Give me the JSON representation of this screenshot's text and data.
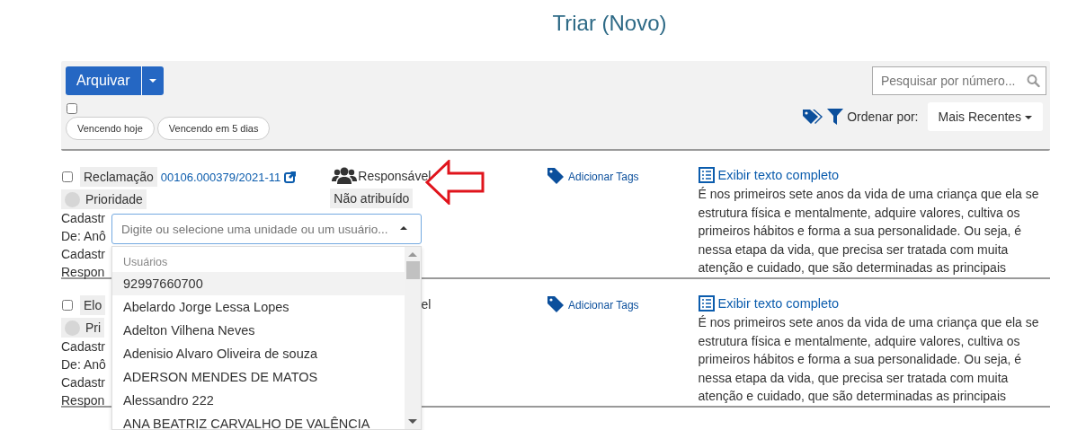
{
  "title": "Triar (Novo)",
  "toolbar": {
    "archive_button": "Arquivar",
    "select_all_checked": false,
    "filters": [
      {
        "label": "Vencendo hoje",
        "selected": false
      },
      {
        "label": "Vencendo em 5 dias",
        "selected": false
      }
    ],
    "search": {
      "placeholder": "Pesquisar por número..."
    },
    "sort_label": "Ordenar por:",
    "sort_value": "Mais Recentes"
  },
  "items": [
    {
      "checked": false,
      "type": "Reclamação",
      "number": "00106.000379/2021-11",
      "responsible_label": "Responsável",
      "priority": "Prioridade",
      "assignee": "Não atribuído",
      "details": [
        "Cadastr",
        "De: Anô",
        "Cadastr",
        "Respon"
      ],
      "tags_link": "Adicionar Tags",
      "full_text_link": "Exibir texto completo",
      "text": "É nos primeiros sete anos da vida de uma criança que ela se estrutura física e mentalmente, adquire valores, cultiva os primeiros hábitos e forma a sua personalidade. Ou seja, é nessa etapa da vida, que precisa ser tratada com muita atenção e cuidado, que são determinadas as principais"
    },
    {
      "checked": false,
      "type": "Elo",
      "responsible_label": "el",
      "priority": "Pri",
      "details": [
        "Cadastr",
        "De: Anô",
        "Cadastr",
        "Respon"
      ],
      "tags_link": "Adicionar Tags",
      "full_text_link": "Exibir texto completo",
      "text": "É nos primeiros sete anos da vida de uma criança que ela se estrutura física e mentalmente, adquire valores, cultiva os primeiros hábitos e forma a sua personalidade. Ou seja, é nessa etapa da vida, que precisa ser tratada com muita atenção e cuidado, que são determinadas as principais"
    }
  ],
  "assign_dropdown": {
    "placeholder": "Digite ou selecione uma unidade ou um usuário...",
    "group": "Usuários",
    "options": [
      {
        "label": "92997660700",
        "selected": true
      },
      {
        "label": "Abelardo Jorge Lessa Lopes",
        "selected": false
      },
      {
        "label": "Adelton Vilhena Neves",
        "selected": false
      },
      {
        "label": "Adenisio Alvaro Oliveira de souza",
        "selected": false
      },
      {
        "label": "ADERSON MENDES DE MATOS",
        "selected": false
      },
      {
        "label": "Alessandro 222",
        "selected": false
      },
      {
        "label": "ANA BEATRIZ CARVALHO DE VALÊNCIA",
        "selected": false
      }
    ]
  }
}
